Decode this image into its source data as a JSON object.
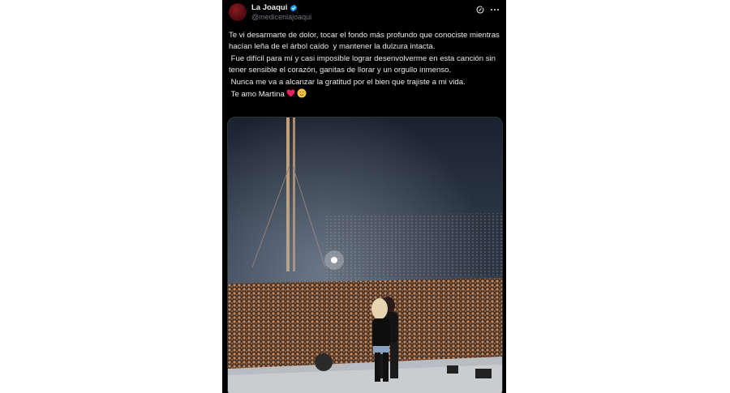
{
  "tweet": {
    "author_name": "La Joaqui",
    "handle": "@medicenlajoaqui",
    "lines": [
      "Te vi desarmarte de dolor, tocar el fondo más profundo que conociste mientras hacían leña de el árbol caído  y mantener la dulzura intacta.",
      " Fue difícil para mí y casi imposible lograr desenvolverme en esta canción sin tener sensible el corazón, ganitas de llorar y un orgullo inmenso.",
      " Nunca me va a alcanzar la gratitud por el bien que trajiste a mi vida.",
      " Te amo Martina"
    ],
    "emojis": [
      "red-heart",
      "smiling-face-with-tear"
    ],
    "media_description": "concert stage photo"
  },
  "colors": {
    "background": "#000000",
    "text": "#e7e9ea",
    "muted": "#71767b",
    "verified": "#1d9bf0",
    "heart": "#e0245e"
  },
  "icons": [
    "verified-badge-icon",
    "grok-icon",
    "more-icon"
  ]
}
